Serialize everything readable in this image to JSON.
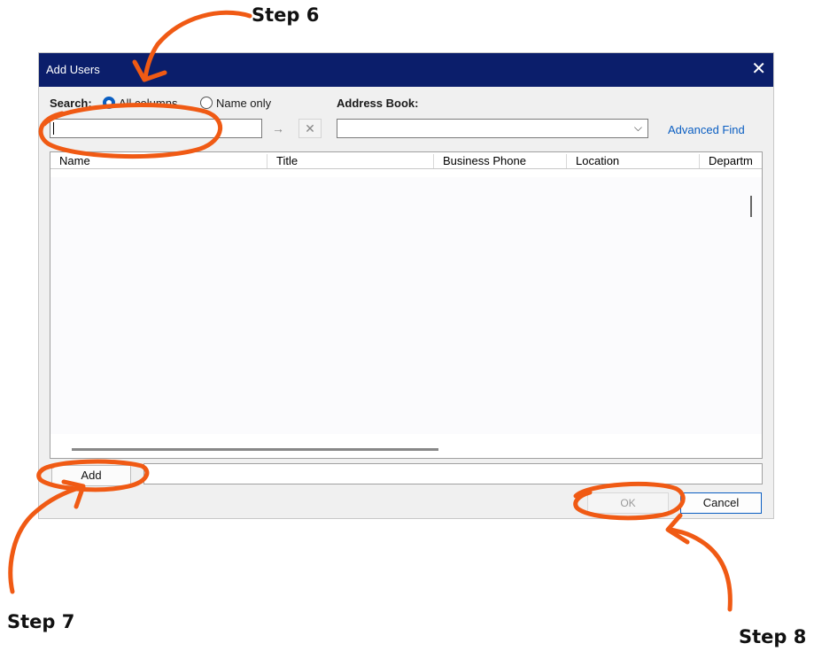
{
  "dialog": {
    "title": "Add Users",
    "close_glyph": "✕",
    "search_label": "Search:",
    "radio_all": "All columns",
    "radio_name": "Name only",
    "address_book_label": "Address Book:",
    "advanced_find": "Advanced Find",
    "go_glyph": "→",
    "clear_glyph": "✕",
    "chevron_glyph": "⌵",
    "columns": [
      "Name",
      "Title",
      "Business Phone",
      "Location",
      "Departm"
    ],
    "add_button": "Add",
    "ok_button": "OK",
    "cancel_button": "Cancel"
  },
  "annotations": {
    "step6": "Step 6",
    "step7": "Step 7",
    "step8": "Step 8",
    "color": "#f05a14"
  },
  "colors": {
    "titlebar": "#0b1e6b",
    "accent": "#0a5ec2"
  },
  "icons": [
    "close-icon",
    "arrow-right-icon",
    "clear-icon",
    "chevron-down-icon"
  ]
}
